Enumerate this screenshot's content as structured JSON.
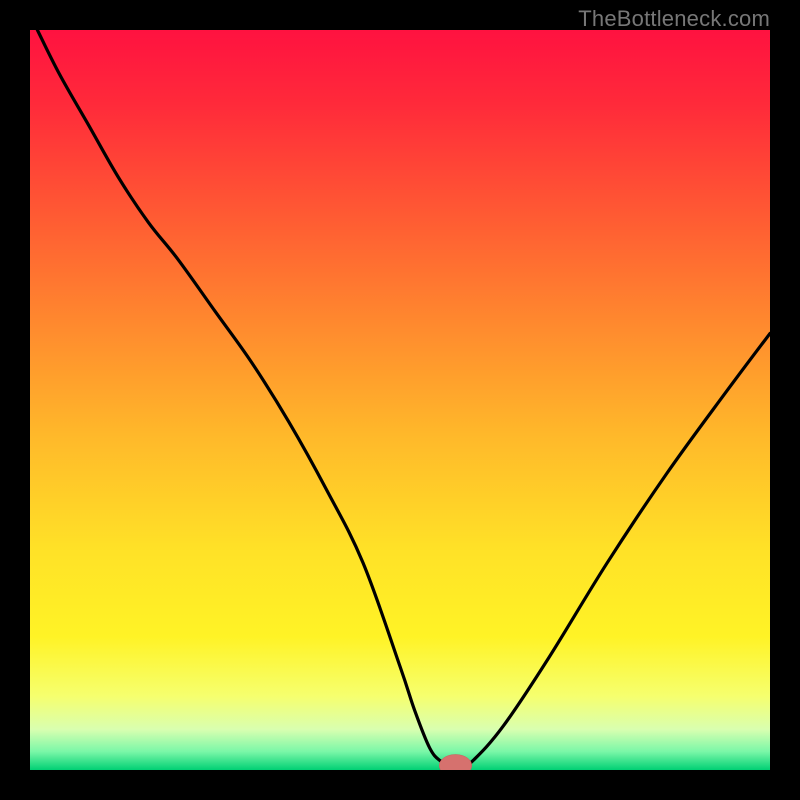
{
  "watermark": "TheBottleneck.com",
  "colors": {
    "frame": "#000000",
    "gradient_stops": [
      {
        "offset": 0.0,
        "color": "#ff1240"
      },
      {
        "offset": 0.1,
        "color": "#ff2a3a"
      },
      {
        "offset": 0.25,
        "color": "#ff5a33"
      },
      {
        "offset": 0.4,
        "color": "#ff8a2e"
      },
      {
        "offset": 0.55,
        "color": "#ffb92a"
      },
      {
        "offset": 0.7,
        "color": "#ffe127"
      },
      {
        "offset": 0.82,
        "color": "#fff326"
      },
      {
        "offset": 0.9,
        "color": "#f6ff6e"
      },
      {
        "offset": 0.945,
        "color": "#d9ffb0"
      },
      {
        "offset": 0.975,
        "color": "#7bf7a8"
      },
      {
        "offset": 1.0,
        "color": "#00d074"
      }
    ],
    "curve": "#000000",
    "marker_fill": "#d6716e",
    "marker_stroke": "#c9605e"
  },
  "chart_data": {
    "type": "line",
    "title": "",
    "xlabel": "",
    "ylabel": "",
    "xlim": [
      0,
      100
    ],
    "ylim": [
      0,
      100
    ],
    "grid": false,
    "legend": false,
    "annotations": [],
    "series": [
      {
        "name": "bottleneck-curve",
        "x": [
          1,
          4,
          8,
          12,
          16,
          20,
          25,
          30,
          35,
          40,
          45,
          50,
          52,
          54,
          55.5,
          57,
          58.5,
          60,
          64,
          70,
          78,
          86,
          94,
          100
        ],
        "y": [
          100,
          94,
          87,
          80,
          74,
          69,
          62,
          55,
          47,
          38,
          28,
          14,
          8,
          3,
          1.2,
          0.6,
          0.6,
          1.4,
          6,
          15,
          28,
          40,
          51,
          59
        ]
      }
    ],
    "marker": {
      "x": 57.5,
      "y": 0.6,
      "rx": 2.2,
      "ry": 1.5
    }
  }
}
